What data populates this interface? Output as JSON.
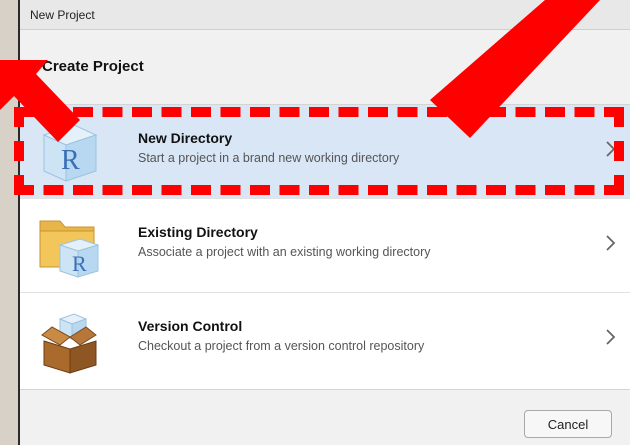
{
  "window": {
    "title": "New Project"
  },
  "dialog": {
    "heading": "Create Project"
  },
  "options": [
    {
      "title": "New Directory",
      "description": "Start a project in a brand new working directory",
      "icon": "r-cube-icon"
    },
    {
      "title": "Existing Directory",
      "description": "Associate a project with an existing working directory",
      "icon": "folder-r-cube-icon"
    },
    {
      "title": "Version Control",
      "description": "Checkout a project from a version control repository",
      "icon": "cardboard-box-icon"
    }
  ],
  "buttons": {
    "cancel": "Cancel"
  },
  "annotations": {
    "color": "#ff0000"
  },
  "colors": {
    "selected_row": "#d8e6f6",
    "dialog_bg": "#f1f1f1"
  }
}
